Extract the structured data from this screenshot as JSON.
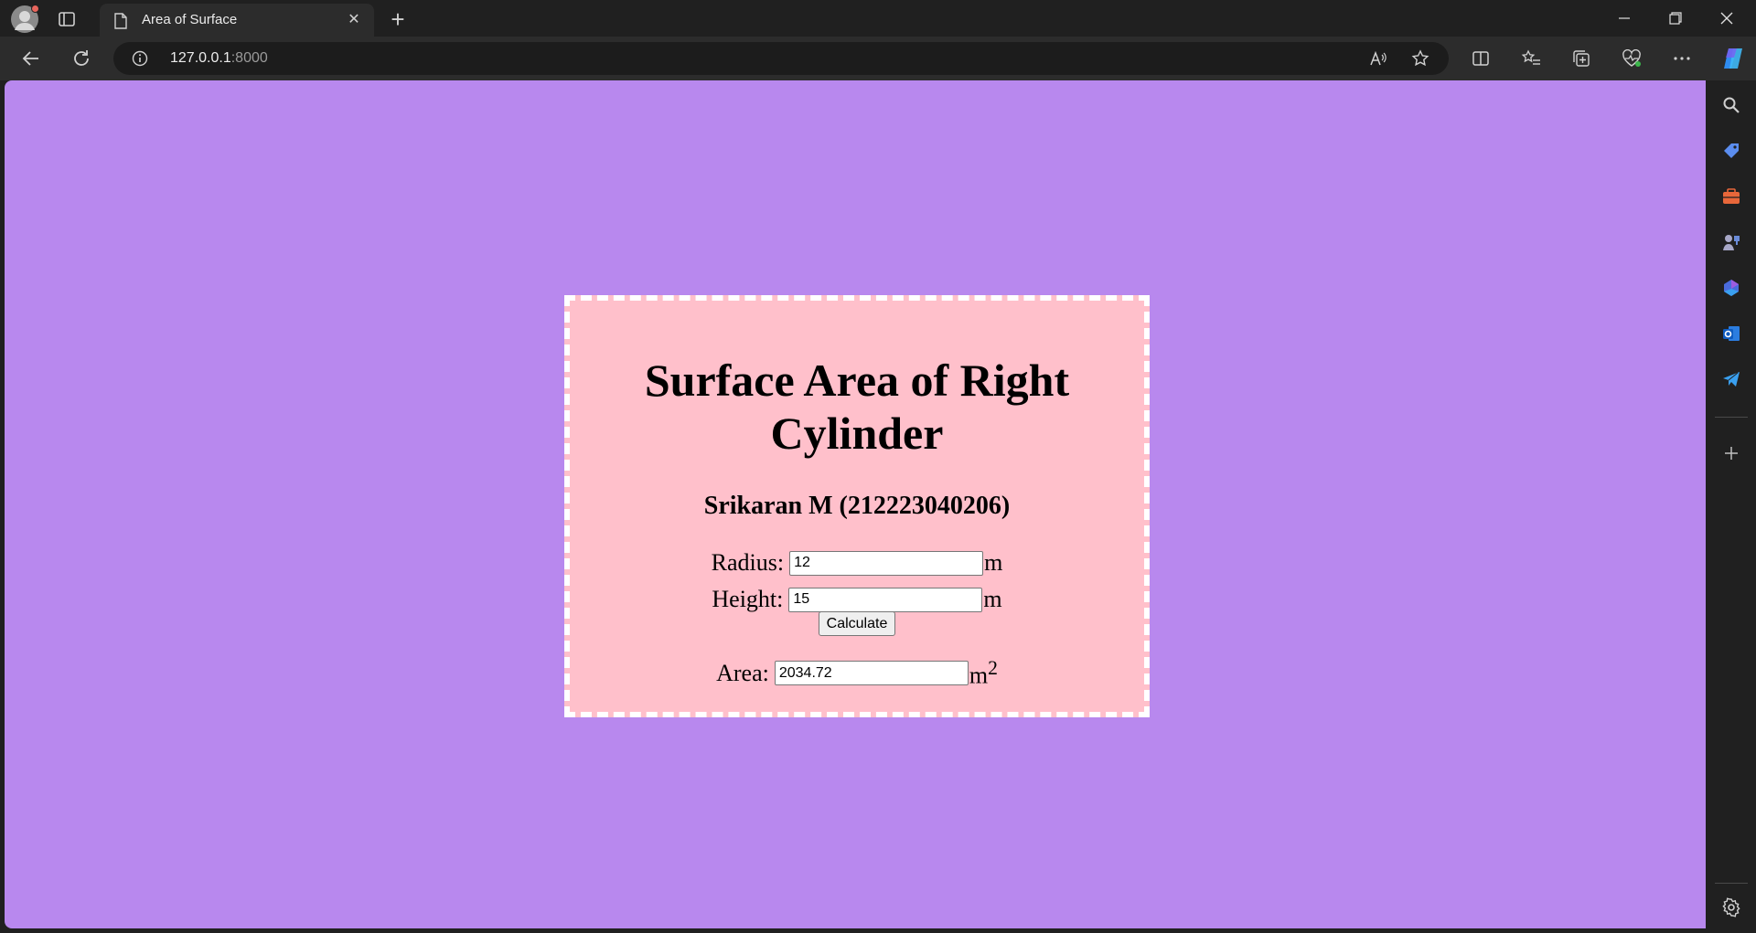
{
  "browser": {
    "tab_title": "Area of Surface",
    "tab_close_label": "✕",
    "new_tab_label": "+",
    "url_host": "127.0.0.1",
    "url_port": ":8000"
  },
  "page": {
    "title_line1": "Surface Area of Right",
    "title_line2": "Cylinder",
    "subtitle": "Srikaran M (212223040206)",
    "radius_label": "Radius:",
    "radius_value": "12",
    "radius_unit": "m",
    "height_label": "Height:",
    "height_value": "15",
    "height_unit": "m",
    "calculate_label": "Calculate",
    "area_label": "Area:",
    "area_value": "2034.72",
    "area_unit": "m",
    "area_unit_power": "2"
  },
  "colors": {
    "page_background": "#b888ee",
    "card_background": "#ffc0cb",
    "card_border": "#ffffff"
  }
}
